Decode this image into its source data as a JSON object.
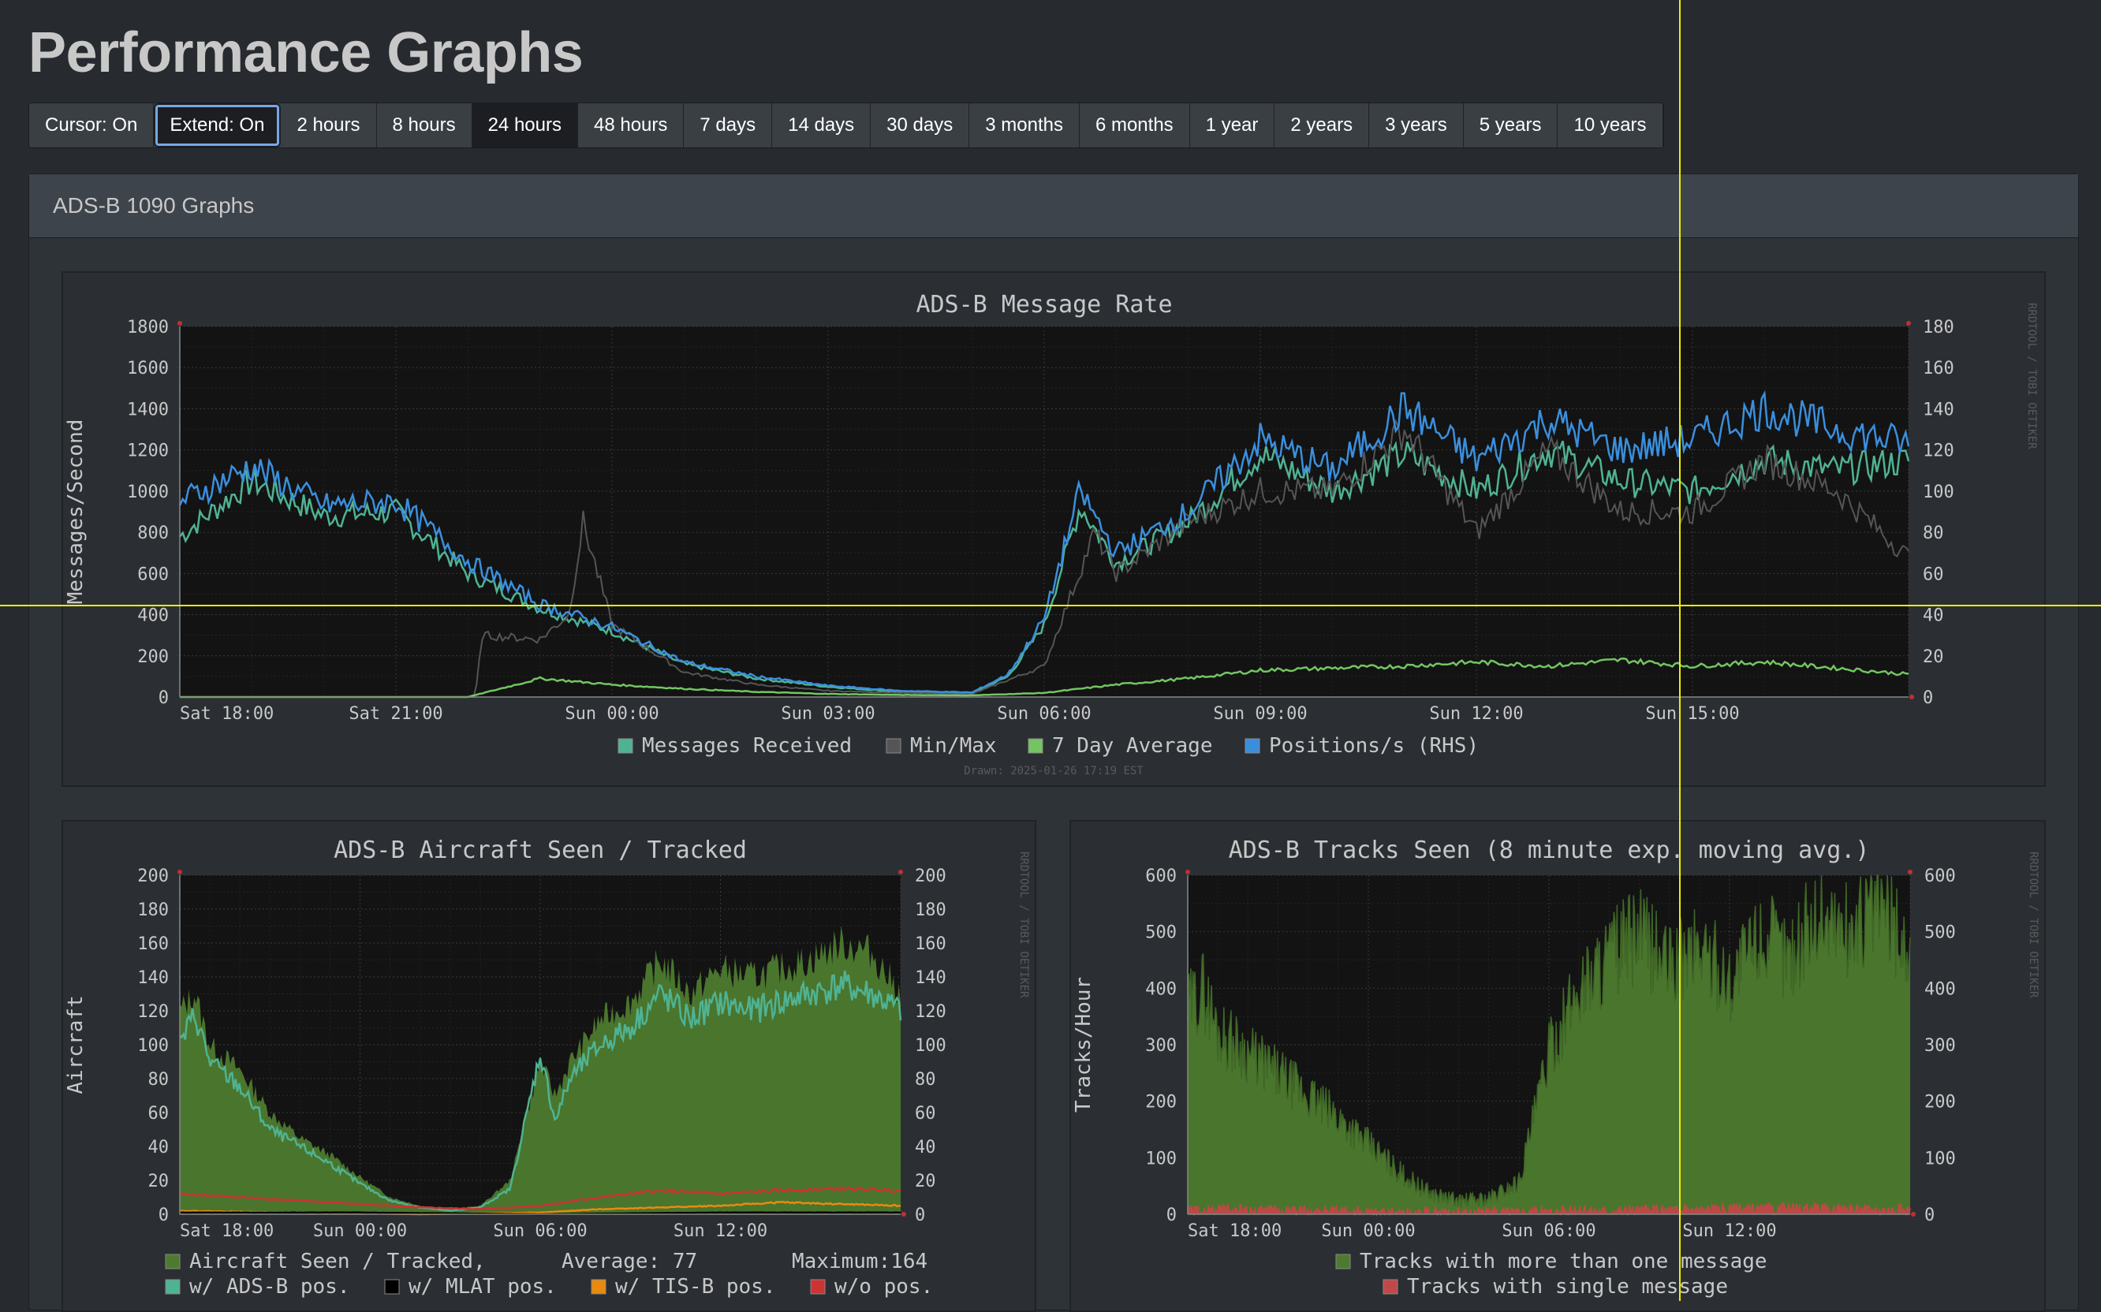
{
  "page": {
    "title": "Performance Graphs"
  },
  "toolbar": {
    "buttons": [
      {
        "label": "Cursor: On",
        "style": "normal"
      },
      {
        "label": "Extend: On",
        "style": "focus"
      },
      {
        "label": "2 hours",
        "style": "normal"
      },
      {
        "label": "8 hours",
        "style": "normal"
      },
      {
        "label": "24 hours",
        "style": "dark"
      },
      {
        "label": "48 hours",
        "style": "normal"
      },
      {
        "label": "7 days",
        "style": "normal"
      },
      {
        "label": "14 days",
        "style": "normal"
      },
      {
        "label": "30 days",
        "style": "normal"
      },
      {
        "label": "3 months",
        "style": "normal"
      },
      {
        "label": "6 months",
        "style": "normal"
      },
      {
        "label": "1 year",
        "style": "normal"
      },
      {
        "label": "2 years",
        "style": "normal"
      },
      {
        "label": "3 years",
        "style": "normal"
      },
      {
        "label": "5 years",
        "style": "normal"
      },
      {
        "label": "10 years",
        "style": "normal"
      }
    ]
  },
  "panel": {
    "heading": "ADS-B 1090 Graphs"
  },
  "chart_data": [
    {
      "type": "line",
      "title": "ADS-B Message Rate",
      "ylabel": "Messages/Second",
      "ylim": [
        0,
        1800
      ],
      "y_ticks": [
        "0",
        "200",
        "400",
        "600",
        "800",
        "1000",
        "1200",
        "1400",
        "1600",
        "1800"
      ],
      "y2_ticks": [
        "0",
        "20",
        "40",
        "60",
        "80",
        "100",
        "120",
        "140",
        "160",
        "180"
      ],
      "x_ticks": [
        "Sat 18:00",
        "Sat 21:00",
        "Sun 00:00",
        "Sun 03:00",
        "Sun 06:00",
        "Sun 09:00",
        "Sun 12:00",
        "Sun 15:00"
      ],
      "x_range_hours": [
        0,
        24
      ],
      "grid": true,
      "legend": [
        {
          "label": "Messages Received",
          "color": "#4fb393"
        },
        {
          "label": "Min/Max",
          "color": "#555555"
        },
        {
          "label": "7 Day Average",
          "color": "#73c562"
        },
        {
          "label": "Positions/s (RHS)",
          "color": "#3a8fdd"
        }
      ],
      "footer": "Drawn: 2025-01-26 17:19 EST",
      "watermark": "RRDTOOL / TOBI OETIKER",
      "series": [
        {
          "name": "Messages Received",
          "color": "#4fb393",
          "x": [
            0,
            1,
            2,
            3,
            4,
            5,
            6,
            7,
            8,
            9,
            10,
            11,
            11.5,
            12,
            12.5,
            13,
            14,
            15,
            16,
            17,
            18,
            19,
            20,
            21,
            22,
            23,
            24
          ],
          "y": [
            780,
            1050,
            880,
            900,
            600,
            430,
            320,
            160,
            90,
            50,
            25,
            20,
            100,
            350,
            930,
            650,
            850,
            1180,
            1000,
            1180,
            1000,
            1200,
            1050,
            1000,
            1150,
            1100,
            1150
          ]
        },
        {
          "name": "Min/Max",
          "color": "#555555",
          "x": [
            0,
            4.1,
            4.2,
            5,
            5.4,
            5.6,
            6,
            7,
            8,
            9,
            10,
            11,
            12,
            12.7,
            13,
            14,
            15,
            16,
            17,
            18,
            19,
            20,
            21,
            22,
            23,
            24
          ],
          "y": [
            0,
            0,
            300,
            280,
            400,
            850,
            350,
            120,
            60,
            30,
            20,
            15,
            150,
            800,
            600,
            850,
            1000,
            1000,
            1300,
            800,
            1200,
            900,
            900,
            1150,
            1000,
            680
          ]
        },
        {
          "name": "7 Day Average",
          "color": "#73c562",
          "x": [
            0,
            4,
            5,
            6,
            7,
            8,
            9,
            10,
            11,
            12,
            13,
            14,
            15,
            16,
            17,
            18,
            19,
            20,
            21,
            22,
            23,
            24
          ],
          "y": [
            0,
            0,
            90,
            60,
            40,
            25,
            15,
            10,
            8,
            20,
            60,
            90,
            130,
            140,
            150,
            170,
            150,
            180,
            150,
            170,
            140,
            110
          ]
        },
        {
          "name": "Positions/s (RHS)",
          "color": "#3a8fdd",
          "x": [
            0,
            1,
            2,
            3,
            4,
            5,
            6,
            7,
            8,
            9,
            10,
            11,
            11.5,
            12,
            12.5,
            13,
            14,
            15,
            16,
            17,
            18,
            19,
            20,
            21,
            22,
            23,
            24
          ],
          "y": [
            950,
            1120,
            930,
            950,
            660,
            450,
            340,
            170,
            100,
            55,
            30,
            22,
            110,
            380,
            1000,
            700,
            900,
            1250,
            1100,
            1400,
            1150,
            1350,
            1200,
            1250,
            1400,
            1300,
            1230
          ]
        }
      ]
    },
    {
      "type": "area",
      "title": "ADS-B Aircraft Seen / Tracked",
      "ylabel": "Aircraft",
      "ylim": [
        0,
        200
      ],
      "y_ticks": [
        "0",
        "20",
        "40",
        "60",
        "80",
        "100",
        "120",
        "140",
        "160",
        "180",
        "200"
      ],
      "x_ticks": [
        "Sat 18:00",
        "Sun 00:00",
        "Sun 06:00",
        "Sun 12:00"
      ],
      "x_range_hours": [
        0,
        24
      ],
      "grid": true,
      "watermark": "RRDTOOL / TOBI OETIKER",
      "legend_row1": {
        "label": "Aircraft Seen / Tracked,",
        "average": "Average: 77",
        "maximum": "Maximum:164",
        "color": "#4d7a2e"
      },
      "legend": [
        {
          "label": "w/ ADS-B pos.",
          "color": "#4fb393"
        },
        {
          "label": "w/ MLAT pos.",
          "color": "#000000"
        },
        {
          "label": "w/ TIS-B pos.",
          "color": "#e88a10"
        },
        {
          "label": "w/o pos.",
          "color": "#cc3333"
        }
      ],
      "series": [
        {
          "name": "Aircraft Seen / Tracked",
          "color": "#4d7a2e",
          "x": [
            0,
            0.5,
            1,
            2,
            3,
            4,
            5,
            6,
            7,
            8,
            9,
            10,
            11,
            12,
            12.5,
            13,
            14,
            15,
            16,
            17,
            18,
            19,
            20,
            21,
            22,
            23,
            24
          ],
          "y": [
            120,
            130,
            100,
            85,
            60,
            45,
            35,
            22,
            10,
            5,
            3,
            5,
            20,
            90,
            70,
            90,
            115,
            125,
            150,
            130,
            145,
            140,
            145,
            150,
            160,
            155,
            130
          ]
        },
        {
          "name": "w/ ADS-B pos.",
          "color": "#4fb393",
          "x": [
            0,
            0.5,
            1,
            2,
            3,
            4,
            5,
            6,
            7,
            8,
            9,
            10,
            11,
            12,
            12.5,
            13,
            14,
            15,
            16,
            17,
            18,
            19,
            20,
            21,
            22,
            23,
            24
          ],
          "y": [
            100,
            118,
            90,
            75,
            50,
            40,
            30,
            18,
            8,
            4,
            2,
            4,
            15,
            95,
            55,
            80,
            100,
            110,
            130,
            115,
            125,
            120,
            125,
            130,
            135,
            130,
            120
          ]
        },
        {
          "name": "w/o pos.",
          "color": "#cc3333",
          "x": [
            0,
            2,
            4,
            6,
            8,
            10,
            12,
            14,
            16,
            18,
            20,
            22,
            24
          ],
          "y": [
            12,
            10,
            8,
            6,
            4,
            3,
            5,
            10,
            14,
            12,
            14,
            15,
            14
          ]
        },
        {
          "name": "w/ TIS-B pos.",
          "color": "#e88a10",
          "x": [
            0,
            4,
            8,
            12,
            14,
            16,
            18,
            20,
            22,
            24
          ],
          "y": [
            2,
            1,
            0,
            1,
            3,
            4,
            5,
            7,
            6,
            5
          ]
        },
        {
          "name": "w/ MLAT pos.",
          "color": "#000000",
          "x": [
            0,
            6,
            12,
            18,
            24
          ],
          "y": [
            1,
            1,
            0,
            1,
            1
          ]
        }
      ]
    },
    {
      "type": "bar",
      "title": "ADS-B Tracks Seen (8 minute exp. moving avg.)",
      "ylabel": "Tracks/Hour",
      "ylim": [
        0,
        630
      ],
      "y_ticks": [
        "0",
        "100",
        "200",
        "300",
        "400",
        "500",
        "600"
      ],
      "x_ticks": [
        "Sat 18:00",
        "Sun 00:00",
        "Sun 06:00",
        "Sun 12:00"
      ],
      "x_range_hours": [
        0,
        24
      ],
      "grid": true,
      "watermark": "RRDTOOL / TOBI OETIKER",
      "legend": [
        {
          "label": "Tracks with more than one message",
          "color": "#4d7a2e"
        },
        {
          "label": "Tracks with single message",
          "color": "#c04848"
        }
      ],
      "series": [
        {
          "name": "Tracks with more than one message",
          "color": "#4d7a2e",
          "x": [
            0,
            0.5,
            1,
            2,
            3,
            4,
            5,
            6,
            7,
            8,
            9,
            10,
            11,
            12,
            13,
            14,
            15,
            16,
            17,
            18,
            19,
            20,
            21,
            22,
            23,
            24
          ],
          "y": [
            380,
            420,
            340,
            300,
            260,
            220,
            180,
            130,
            80,
            40,
            25,
            30,
            60,
            300,
            420,
            480,
            520,
            460,
            500,
            430,
            520,
            480,
            560,
            520,
            580,
            480
          ]
        },
        {
          "name": "Tracks with single message",
          "color": "#c04848",
          "x": [
            0,
            4,
            8,
            12,
            16,
            20,
            24
          ],
          "y": [
            8,
            6,
            3,
            5,
            8,
            10,
            8
          ]
        }
      ]
    }
  ]
}
